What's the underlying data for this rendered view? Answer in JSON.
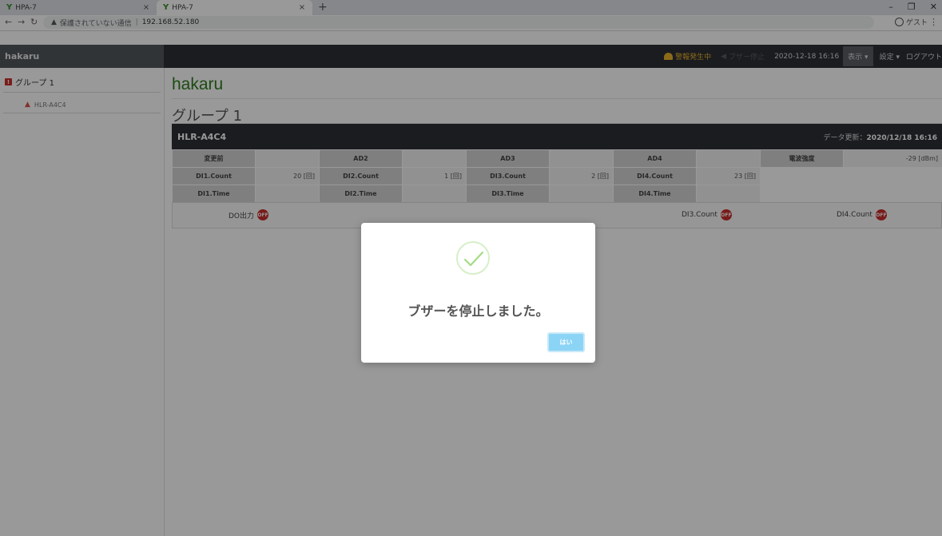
{
  "browser": {
    "tabs": [
      {
        "title": "HPA-7"
      },
      {
        "title": "HPA-7"
      }
    ],
    "new_tab": "+",
    "close_glyph": "×",
    "window_controls": [
      "–",
      "❐",
      "✕"
    ],
    "address": {
      "security_label": "保護されていない通信",
      "url": "192.168.52.180"
    },
    "profile_label": "ゲスト"
  },
  "header": {
    "brand": "hakaru",
    "alarm_label": "警報発生中",
    "buzzer_label": "ブザー停止",
    "datetime": "2020-12-18 16:16",
    "display_menu": "表示",
    "settings_menu": "設定",
    "logout": "ログアウト"
  },
  "sidebar": {
    "group": {
      "badge": "!",
      "label": "グループ 1"
    },
    "device": {
      "label": "HLR-A4C4"
    }
  },
  "main": {
    "app_title": "hakaru",
    "group_title": "グループ 1",
    "device": {
      "name": "HLR-A4C4",
      "update_label": "データ更新：",
      "update_time": "2020/12/18 16:16"
    },
    "table": {
      "row1": [
        {
          "label": "変更前",
          "value": ""
        },
        {
          "label": "AD2",
          "value": ""
        },
        {
          "label": "AD3",
          "value": ""
        },
        {
          "label": "AD4",
          "value": ""
        },
        {
          "label": "電波強度",
          "value": "-29 [dBm]"
        }
      ],
      "row2": [
        {
          "label": "DI1.Count",
          "value": "20 [回]"
        },
        {
          "label": "DI2.Count",
          "value": "1 [回]"
        },
        {
          "label": "DI3.Count",
          "value": "2 [回]"
        },
        {
          "label": "DI4.Count",
          "value": "23 [回]"
        }
      ],
      "row3": [
        {
          "label": "DI1.Time",
          "value": ""
        },
        {
          "label": "DI2.Time",
          "value": ""
        },
        {
          "label": "DI3.Time",
          "value": ""
        },
        {
          "label": "DI4.Time",
          "value": ""
        }
      ]
    },
    "status_items": [
      {
        "label": "DO出力",
        "state": "OFF"
      },
      {
        "label": "DI3.Count",
        "state": "OFF"
      },
      {
        "label": "DI4.Count",
        "state": "OFF"
      }
    ]
  },
  "modal": {
    "message": "ブザーを停止しました。",
    "ok_label": "はい",
    "icon": "check-icon"
  },
  "colors": {
    "nav_bg": "#2d3036",
    "brand_green": "#2f7d1e",
    "alarm": "#e8b22a",
    "off_badge": "#c9302c",
    "ok_button": "#8cd4f5"
  }
}
